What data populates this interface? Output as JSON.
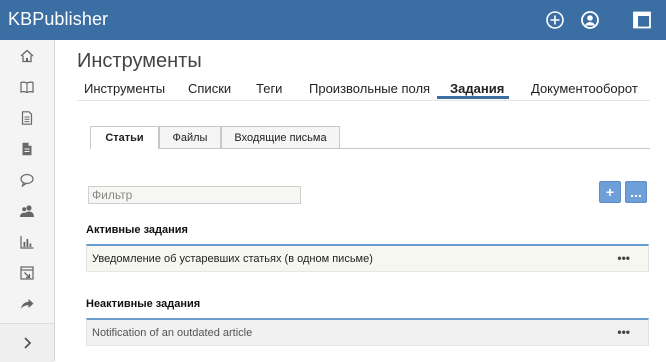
{
  "app": {
    "brand": "KBPublisher",
    "accent": "#3b6ea3",
    "top_icons": [
      "add-circle-icon",
      "user-icon",
      "window-icon"
    ]
  },
  "sidebar": {
    "items": [
      {
        "icon": "home-icon"
      },
      {
        "icon": "book-icon"
      },
      {
        "icon": "document-icon"
      },
      {
        "icon": "file-icon"
      },
      {
        "icon": "chat-icon"
      },
      {
        "icon": "users-icon"
      },
      {
        "icon": "bar-chart-icon"
      },
      {
        "icon": "import-icon"
      },
      {
        "icon": "share-icon"
      }
    ],
    "collapse_icon": "chevron-right-icon"
  },
  "page": {
    "title": "Инструменты"
  },
  "main_tabs": [
    {
      "label": "Инструменты",
      "active": false
    },
    {
      "label": "Списки",
      "active": false
    },
    {
      "label": "Теги",
      "active": false
    },
    {
      "label": "Произвольные поля",
      "active": false
    },
    {
      "label": "Задания",
      "active": true
    },
    {
      "label": "Документооборот",
      "active": false
    }
  ],
  "sub_tabs": [
    {
      "label": "Статьи",
      "active": true
    },
    {
      "label": "Файлы",
      "active": false
    },
    {
      "label": "Входящие письма",
      "active": false
    }
  ],
  "filter": {
    "placeholder": "Фильтр",
    "value": ""
  },
  "toolbar": {
    "add_label": "+",
    "more_label": "..."
  },
  "active_section": {
    "title": "Активные задания",
    "rows": [
      {
        "label": "Уведомление об устаревших статьях (в одном письме)",
        "menu": "•••"
      }
    ]
  },
  "inactive_section": {
    "title": "Неактивные задания",
    "rows": [
      {
        "label": "Notification of an outdated article",
        "menu": "•••"
      }
    ]
  }
}
